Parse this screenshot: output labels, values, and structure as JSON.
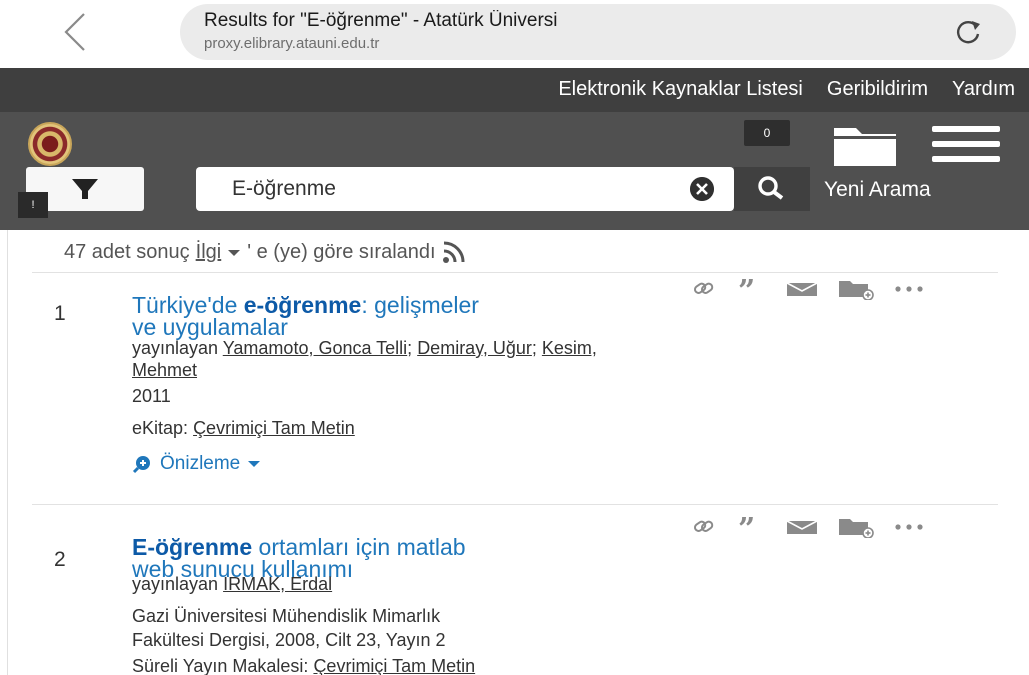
{
  "browser": {
    "title": "Results for \"E-öğrenme\" - Atatürk Üniversi",
    "host": "proxy.elibrary.atauni.edu.tr"
  },
  "header": {
    "links": [
      "Elektronik Kaynaklar Listesi",
      "Geribildirim",
      "Yardım"
    ],
    "folder_count": "0",
    "alert_badge": "!",
    "search_value": "E-öğrenme",
    "new_search": "Yeni Arama"
  },
  "summary": {
    "count_text": "47 adet sonuç",
    "sort_link": "İlgi",
    "sort_suffix": "' e (ye) göre sıralandı"
  },
  "results": [
    {
      "number": "1",
      "title_prefix": "Türkiye'de ",
      "title_highlight": "e-öğrenme",
      "title_rest_line1": ": gelişmeler",
      "title_line2": "ve uygulamalar",
      "by_label": "yayınlayan",
      "authors": [
        "Yamamoto, Gonca Telli",
        "Demiray, Uğur",
        "Kesim,"
      ],
      "authors_line2": "Mehmet",
      "year": "2011",
      "format_label": "eKitap:",
      "access_link": "Çevrimiçi Tam Metin",
      "preview_label": "Önizleme"
    },
    {
      "number": "2",
      "title_highlight": "E-öğrenme",
      "title_rest_line1": " ortamları için matlab",
      "title_line2": "web sunucu kullanımı",
      "by_label": "yayınlayan",
      "authors": [
        "IRMAK, Erdal"
      ],
      "source_line1": "Gazi Üniversitesi Mühendislik Mimarlık",
      "source_line2": "Fakültesi Dergisi, 2008, Cilt 23, Yayın 2",
      "format_label": "Süreli Yayın Makalesi:",
      "access_link": "Çevrimiçi Tam Metin"
    }
  ],
  "colors": {
    "link": "#1f77bb",
    "header_dark": "#3f3f3f",
    "header_mid": "#505050"
  },
  "icons": [
    "back-chevron-icon",
    "reload-icon",
    "folder-icon",
    "menu-icon",
    "filter-icon",
    "clear-icon",
    "search-icon",
    "rss-icon",
    "link-icon",
    "quote-icon",
    "email-icon",
    "add-folder-icon",
    "more-icon",
    "preview-icon"
  ]
}
